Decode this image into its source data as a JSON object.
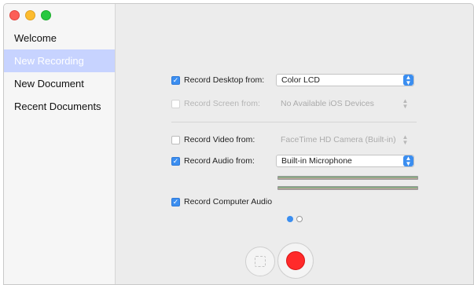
{
  "window": {
    "traffic_lights": [
      "close",
      "minimize",
      "zoom"
    ]
  },
  "sidebar": {
    "items": [
      {
        "label": "Welcome",
        "selected": false
      },
      {
        "label": "New Recording",
        "selected": true
      },
      {
        "label": "New Document",
        "selected": false
      },
      {
        "label": "Recent Documents",
        "selected": false
      }
    ]
  },
  "settings": {
    "desktop": {
      "label": "Record Desktop from:",
      "checked": true,
      "enabled": true,
      "value": "Color LCD"
    },
    "screen": {
      "label": "Record Screen from:",
      "checked": false,
      "enabled": false,
      "value": "No Available iOS Devices"
    },
    "video": {
      "label": "Record Video from:",
      "checked": false,
      "enabled": true,
      "value": "FaceTime HD Camera (Built-in)"
    },
    "audio": {
      "label": "Record Audio from:",
      "checked": true,
      "enabled": true,
      "value": "Built-in Microphone"
    },
    "computer_audio": {
      "label": "Record Computer Audio",
      "checked": true
    }
  },
  "pager": {
    "pages": 2,
    "current": 1
  },
  "colors": {
    "accent": "#3b8ef0",
    "record": "#ff2a2a",
    "selection": "#c7d3ff"
  }
}
